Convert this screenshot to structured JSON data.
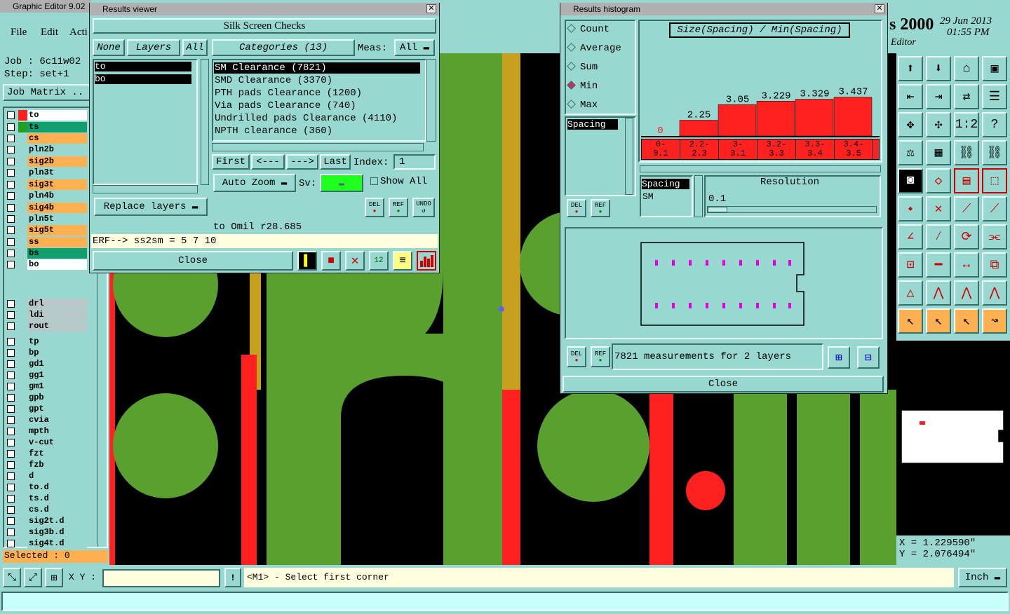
{
  "app": {
    "title": "Graphic Editor 9.02",
    "brand": "s 2000",
    "date": "29 Jun 2013",
    "time": "01:55 PM",
    "subtitle": "Editor"
  },
  "menu": {
    "file": "File",
    "edit": "Edit",
    "actions": "Acti"
  },
  "job": {
    "job": "Job  :  6c11w02",
    "step": "Step: set+1",
    "matrix": "Job Matrix .."
  },
  "layers": [
    {
      "name": "to",
      "color": "#ffffff",
      "swatch": "#ff2020"
    },
    {
      "name": "ts",
      "color": "#10a070",
      "swatch": "#20a020"
    },
    {
      "name": "cs",
      "color": "#ffb050"
    },
    {
      "name": "pln2b",
      "color": "#98d8d0"
    },
    {
      "name": "sig2b",
      "color": "#ffb050"
    },
    {
      "name": "pln3t",
      "color": "#98d8d0"
    },
    {
      "name": "sig3t",
      "color": "#ffb050"
    },
    {
      "name": "pln4b",
      "color": "#98d8d0"
    },
    {
      "name": "sig4b",
      "color": "#ffb050"
    },
    {
      "name": "pln5t",
      "color": "#98d8d0"
    },
    {
      "name": "sig5t",
      "color": "#ffb050"
    },
    {
      "name": "ss",
      "color": "#ffb050"
    },
    {
      "name": "bs",
      "color": "#10a070"
    },
    {
      "name": "bo",
      "color": "#ffffff"
    }
  ],
  "layers2": [
    "drl",
    "ldi",
    "rout"
  ],
  "layers3": [
    "tp",
    "bp",
    "gd1",
    "gg1",
    "gm1",
    "gpb",
    "gpt",
    "cvia",
    "mpth",
    "v-cut",
    "fzt",
    "fzb",
    "d",
    "to.d",
    "ts.d",
    "cs.d",
    "sig2t.d",
    "sig3b.d",
    "sig4t.d"
  ],
  "selected": "Selected : 0",
  "viewer": {
    "title": "Results viewer",
    "header": "Silk Screen Checks",
    "none": "None",
    "layers_lbl": "Layers",
    "all": "All",
    "layer_list": [
      "to",
      "bo"
    ],
    "categories": "Categories (13)",
    "meas": "Meas:",
    "meas_value": "All",
    "items": [
      "SM Clearance (7821)",
      "SMD Clearance (3370)",
      "PTH pads Clearance (1200)",
      "Via pads Clearance (740)",
      "Undrilled pads Clearance (4110)",
      "NPTH clearance (360)"
    ],
    "first": "First",
    "prev": "<---",
    "next": "--->",
    "last": "Last",
    "index_lbl": "Index:",
    "index": "1",
    "replace": "Replace layers",
    "autozoom": "Auto Zoom",
    "sv": "Sv:",
    "showall": "Show All",
    "del": "DEL",
    "ref": "REF",
    "undo": "UNDO",
    "status": "to Omil  r28.685",
    "erf": "ERF--> ss2sm = 5 7 10",
    "close": "Close"
  },
  "histogram": {
    "title": "Results histogram",
    "options": [
      "Count",
      "Average",
      "Sum",
      "Min",
      "Max"
    ],
    "selected_option": "Min",
    "formula": "Size(Spacing) / Min(Spacing)",
    "field": "Spacing",
    "field2": "Spacing",
    "field2b": "SM",
    "resolution_lbl": "Resolution",
    "resolution": "0.1",
    "summary": "7821 measurements for 2 layers",
    "close": "Close"
  },
  "chart_data": {
    "type": "bar",
    "categories": [
      "0-0.1",
      "2.2-2.3",
      "3-3.1",
      "3.2-3.3",
      "3.3-3.4",
      "3.4-3.5"
    ],
    "values": [
      0,
      2.25,
      3.05,
      3.229,
      3.329,
      3.437
    ],
    "value_labels": [
      "0",
      "2.25",
      "3.05",
      "3.229",
      "3.329",
      "3.437"
    ],
    "title": "Size(Spacing) / Min(Spacing)",
    "bar_color": "#ff2020"
  },
  "bottom": {
    "xy": "X Y :",
    "prompt": "<M1> - Select first corner",
    "units": "Inch"
  },
  "coords": {
    "x": "X = 1.229590\"",
    "y": "Y = 2.076494\""
  }
}
